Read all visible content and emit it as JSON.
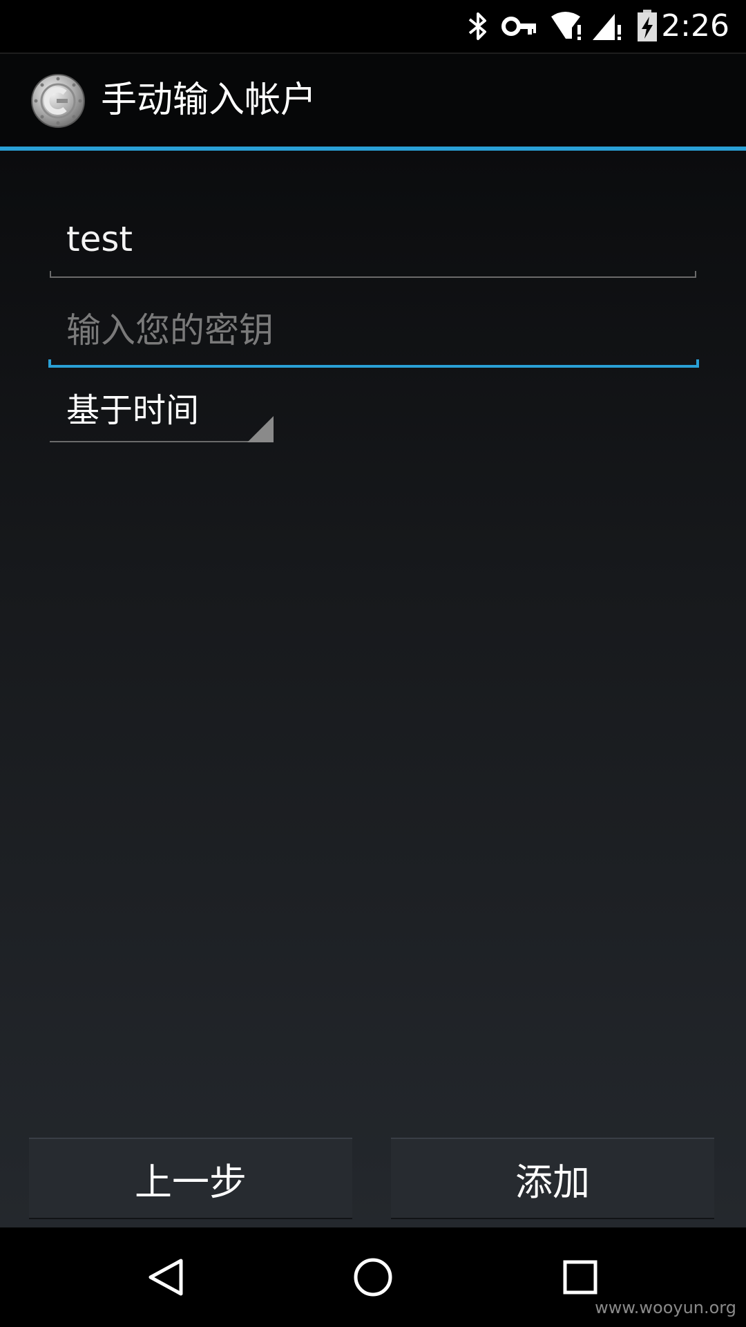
{
  "status_bar": {
    "time": "2:26",
    "icons": [
      "bluetooth-icon",
      "vpn-key-icon",
      "wifi-warning-icon",
      "cell-signal-warning-icon",
      "battery-charging-icon"
    ]
  },
  "action_bar": {
    "title": "手动输入帐户",
    "logo_icon": "authenticator-logo-icon"
  },
  "form": {
    "account_name": "test",
    "key_placeholder": "输入您的密钥",
    "key_type_selected": "基于时间"
  },
  "buttons": {
    "prev_label": "上一步",
    "add_label": "添加"
  },
  "nav_bar": {
    "icons": [
      "back-icon",
      "home-icon",
      "recents-icon"
    ]
  },
  "watermark": "www.wooyun.org",
  "colors": {
    "accent": "#2aa0d6",
    "button_bg": "#272b30",
    "placeholder": "#7a7a7a"
  }
}
